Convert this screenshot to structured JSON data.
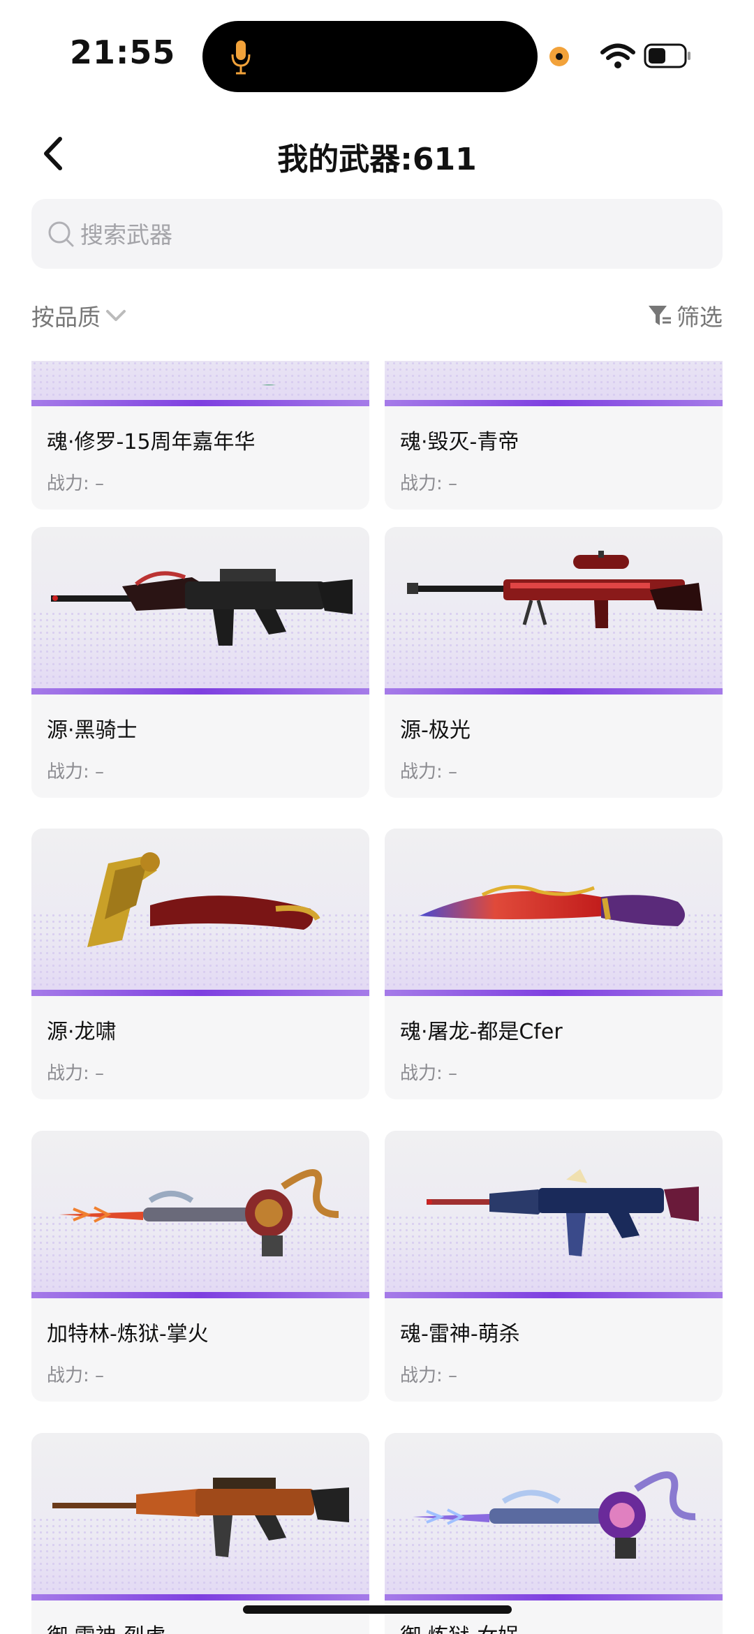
{
  "status_bar": {
    "time": "21:55"
  },
  "header": {
    "title": "我的武器:611"
  },
  "search": {
    "placeholder": "搜索武器"
  },
  "toolbar": {
    "sort_label": "按品质",
    "filter_label": "筛选"
  },
  "accent_color": "#7e3fe0",
  "weapons": [
    {
      "name": "魂·修罗-15周年嘉年华",
      "power": "战力: –",
      "icon": "rifle-icon"
    },
    {
      "name": "魂·毁灭-青帝",
      "power": "战力: –",
      "icon": "sniper-icon"
    },
    {
      "name": "源·黑骑士",
      "power": "战力: –",
      "icon": "rifle-icon"
    },
    {
      "name": "源-极光",
      "power": "战力: –",
      "icon": "sniper-icon"
    },
    {
      "name": "源·龙啸",
      "power": "战力: –",
      "icon": "axe-icon"
    },
    {
      "name": "魂·屠龙-都是Cfer",
      "power": "战力: –",
      "icon": "knife-icon"
    },
    {
      "name": "加特林-炼狱-掌火",
      "power": "战力: –",
      "icon": "gatling-icon"
    },
    {
      "name": "魂-雷神-萌杀",
      "power": "战力: –",
      "icon": "rifle-icon"
    },
    {
      "name": "御·雷神-烈虎",
      "power": "",
      "icon": "rifle-icon"
    },
    {
      "name": "御·炼狱-女娲",
      "power": "",
      "icon": "gatling-icon"
    }
  ]
}
